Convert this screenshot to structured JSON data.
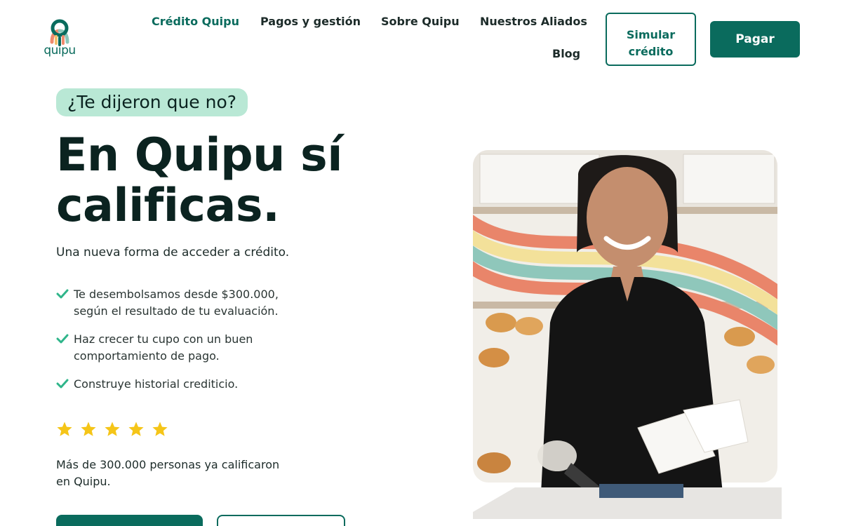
{
  "header": {
    "logo_text": "quipu",
    "nav": [
      {
        "label": "Crédito Quipu",
        "active": true
      },
      {
        "label": "Pagos y gestión",
        "active": false
      },
      {
        "label": "Sobre Quipu",
        "active": false
      },
      {
        "label": "Nuestros Aliados",
        "active": false
      },
      {
        "label": "Blog",
        "active": false
      }
    ],
    "simulate_button": {
      "line1": "Simular",
      "line2": "crédito"
    },
    "pay_button": "Pagar"
  },
  "hero": {
    "pill": "¿Te dijeron que no?",
    "headline_line1": "En Quipu sí",
    "headline_line2": "calificas.",
    "subtitle": "Una nueva forma de acceder a crédito.",
    "bullets": [
      {
        "text": "Te desembolsamos desde $300.000, según el resultado de tu evaluación."
      },
      {
        "text": "Haz crecer tu cupo con un buen comportamiento de pago."
      },
      {
        "text": "Construye historial crediticio."
      }
    ],
    "rating": {
      "stars": 5,
      "max": 5
    },
    "social_proof": "Más de 300.000 personas ya calificaron en Quipu."
  },
  "colors": {
    "brand": "#0a6b5d",
    "pill_bg": "#b9e8d5",
    "check": "#2fb58a",
    "star": "#f5c518",
    "stripe_orange": "#e9856a",
    "stripe_yellow": "#f3e19a",
    "stripe_teal": "#8fc7bb"
  },
  "icons": {
    "logo": "quipu-logo-icon",
    "check": "check-icon",
    "star": "star-icon"
  }
}
